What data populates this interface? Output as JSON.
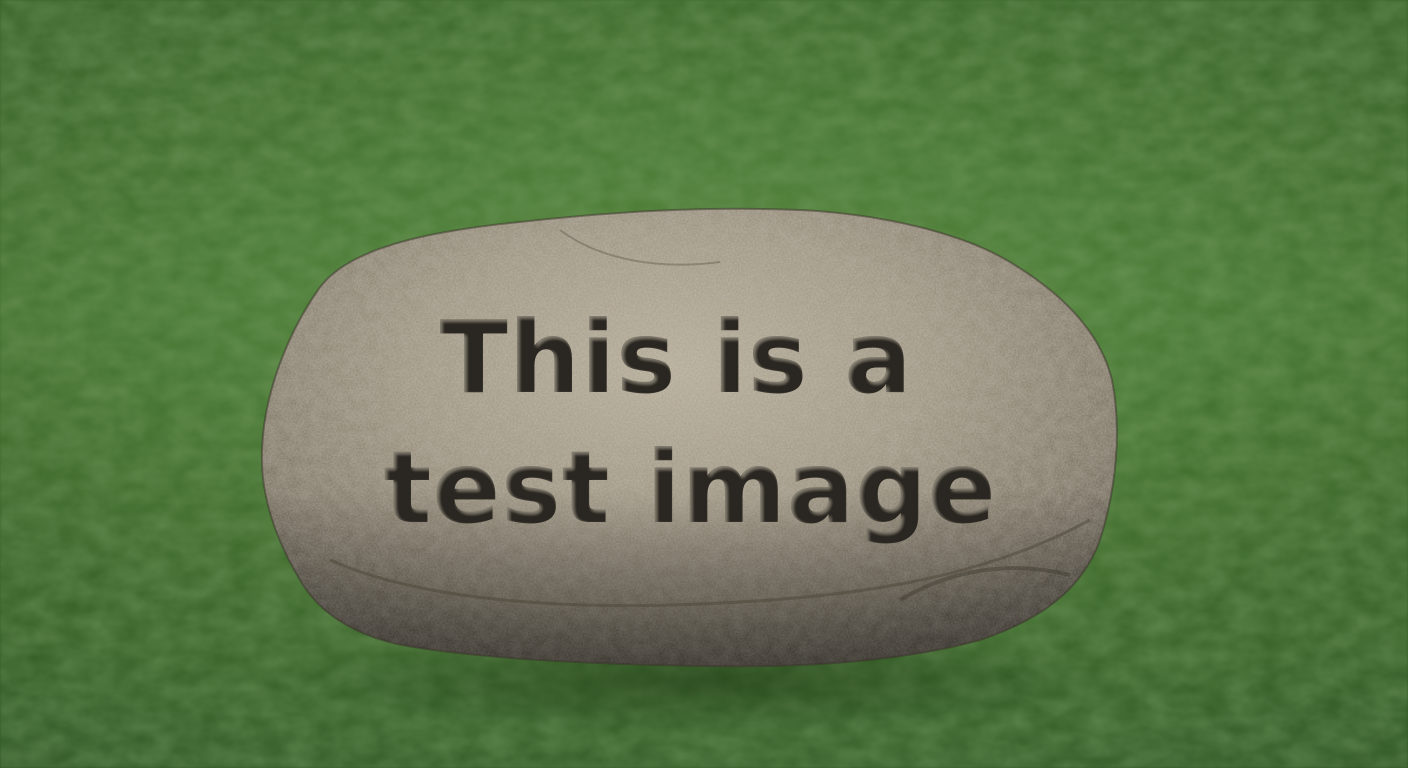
{
  "carving": {
    "line1": "This is a",
    "line2": "test image"
  },
  "colors": {
    "grass": "#4a7d34",
    "grass_dark": "#35612a",
    "rock_light": "#a89d86",
    "rock_mid": "#8c8270",
    "rock_dark": "#5a5244",
    "engraving": "#2b2620"
  }
}
